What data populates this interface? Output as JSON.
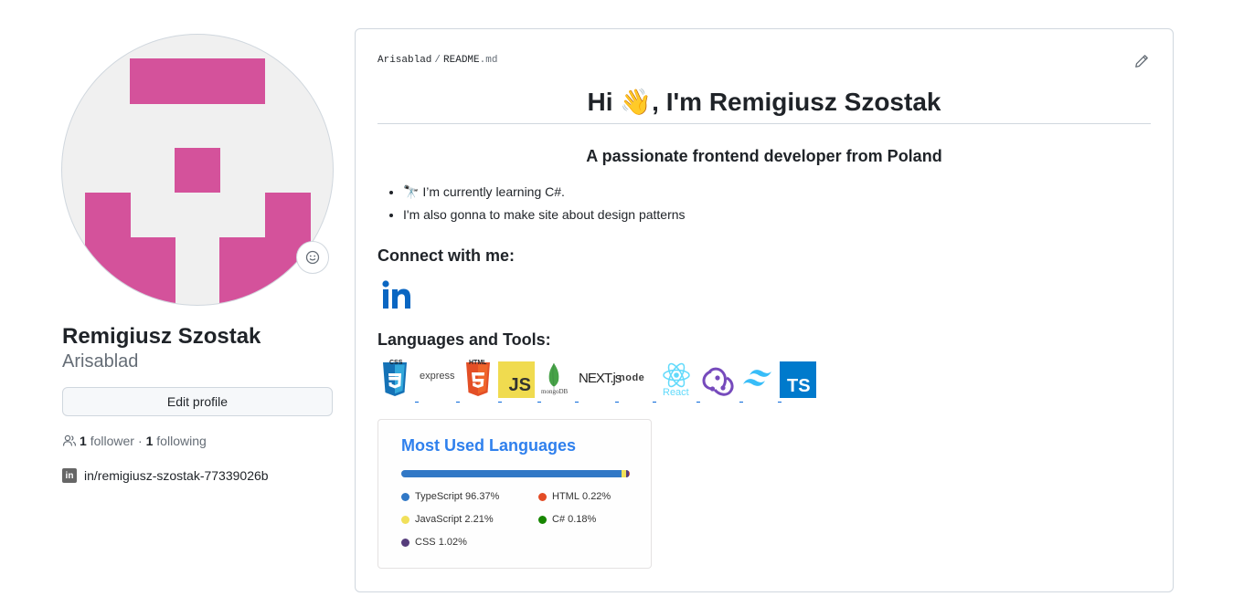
{
  "profile": {
    "full_name": "Remigiusz Szostak",
    "username": "Arisablad",
    "edit_label": "Edit profile",
    "followers_count": "1",
    "followers_label": "follower",
    "separator": "·",
    "following_count": "1",
    "following_label": "following",
    "linkedin_icon_text": "in",
    "linkedin_text": "in/remigiusz-szostak-77339026b",
    "avatar_color": "#d4529b"
  },
  "readme": {
    "owner": "Arisablad",
    "separator": "/",
    "file_name": "README",
    "file_ext": ".md",
    "title": "Hi 👋, I'm Remigiusz Szostak",
    "subtitle": "A passionate frontend developer from Poland",
    "bullets": [
      "🔭 I’m currently learning C#.",
      "I'm also gonna to make site about design patterns"
    ],
    "connect_heading": "Connect with me:",
    "linkedin_logo_text": "in",
    "languages_heading": "Languages and Tools:",
    "tools": [
      {
        "name": "css3",
        "label": "CSS"
      },
      {
        "name": "express",
        "label": "express"
      },
      {
        "name": "html5",
        "label": "HTML"
      },
      {
        "name": "javascript",
        "label": "JS"
      },
      {
        "name": "mongodb",
        "label": "mongoDB"
      },
      {
        "name": "nextjs",
        "label": "NEXT.js"
      },
      {
        "name": "nodejs",
        "label": "node"
      },
      {
        "name": "react",
        "label": "React"
      },
      {
        "name": "redux",
        "label": ""
      },
      {
        "name": "tailwind",
        "label": ""
      },
      {
        "name": "typescript",
        "label": "TS"
      }
    ]
  },
  "stats": {
    "title": "Most Used Languages",
    "languages": [
      {
        "name": "TypeScript",
        "percent": "96.37%",
        "value": 96.37,
        "color": "#3178c6"
      },
      {
        "name": "HTML",
        "percent": "0.22%",
        "value": 0.22,
        "color": "#e34c26"
      },
      {
        "name": "JavaScript",
        "percent": "2.21%",
        "value": 2.21,
        "color": "#f1e05a"
      },
      {
        "name": "C#",
        "percent": "0.18%",
        "value": 0.18,
        "color": "#178600"
      },
      {
        "name": "CSS",
        "percent": "1.02%",
        "value": 1.02,
        "color": "#563d7c"
      }
    ]
  }
}
